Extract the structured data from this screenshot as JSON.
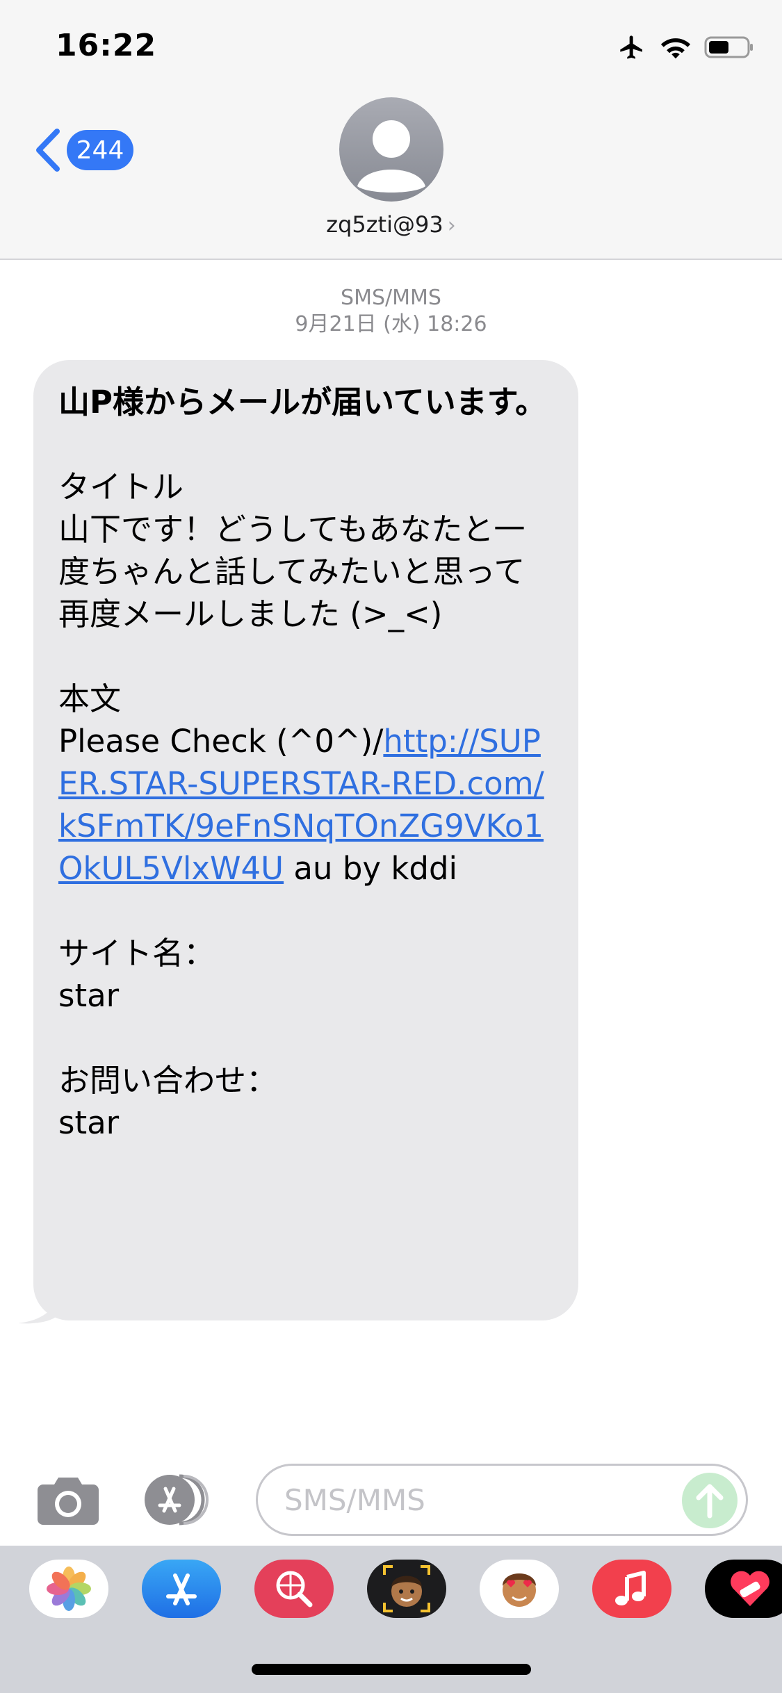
{
  "status_bar": {
    "time": "16:22"
  },
  "nav": {
    "back_count": "244",
    "contact": "zq5zti@93",
    "contact_chevron": "›"
  },
  "thread": {
    "service": "SMS/MMS",
    "timestamp": "9月21日 (水) 18:26"
  },
  "message": {
    "headline": "山P様からメールが届いています。",
    "body_1": "\n\nタイトル\n山下です！どうしてもあなたと一度ちゃんと話してみたいと思って再度メールしました (>_<)\n\n本文\nPlease Check (^0^)/",
    "link": "http://SUPER.STAR-SUPERSTAR-RED.com/kSFmTK/9eFnSNqTOnZG9VKo1OkUL5VlxW4U",
    "body_2": " au by kddi\n\nサイト名：\nstar\n\nお問い合わせ：\nstar"
  },
  "compose": {
    "placeholder": "SMS/MMS"
  },
  "app_drawer": {
    "apps": [
      "photos",
      "app-store",
      "web-search",
      "memoji",
      "animoji-stickers",
      "music",
      "heart-stickers"
    ]
  },
  "colors": {
    "accent": "#3478f6",
    "link": "#2f6fe0",
    "bubble": "#e9e9eb",
    "send": "#c8ecce",
    "music": "#f2404d"
  }
}
